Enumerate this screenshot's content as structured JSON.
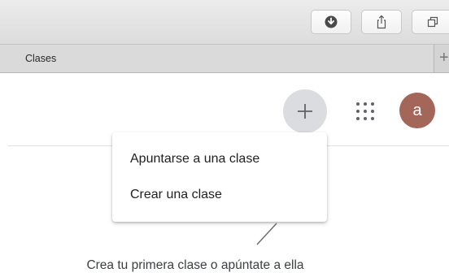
{
  "browser": {
    "toolbar": {
      "buttons": [
        {
          "icon": "download-icon"
        },
        {
          "icon": "share-icon"
        },
        {
          "icon": "tabs-overview-icon"
        }
      ]
    },
    "tab": {
      "title": "Clases"
    },
    "new_tab_icon": "plus-icon"
  },
  "header": {
    "add_button_icon": "plus-icon",
    "apps_icon": "apps-grid-icon",
    "avatar_letter": "a",
    "avatar_color": "#a5665a"
  },
  "menu": {
    "items": [
      {
        "label": "Apuntarse a una clase"
      },
      {
        "label": "Crear una clase"
      }
    ]
  },
  "empty_state": {
    "hint": "Crea tu primera clase o apúntate a ella"
  }
}
